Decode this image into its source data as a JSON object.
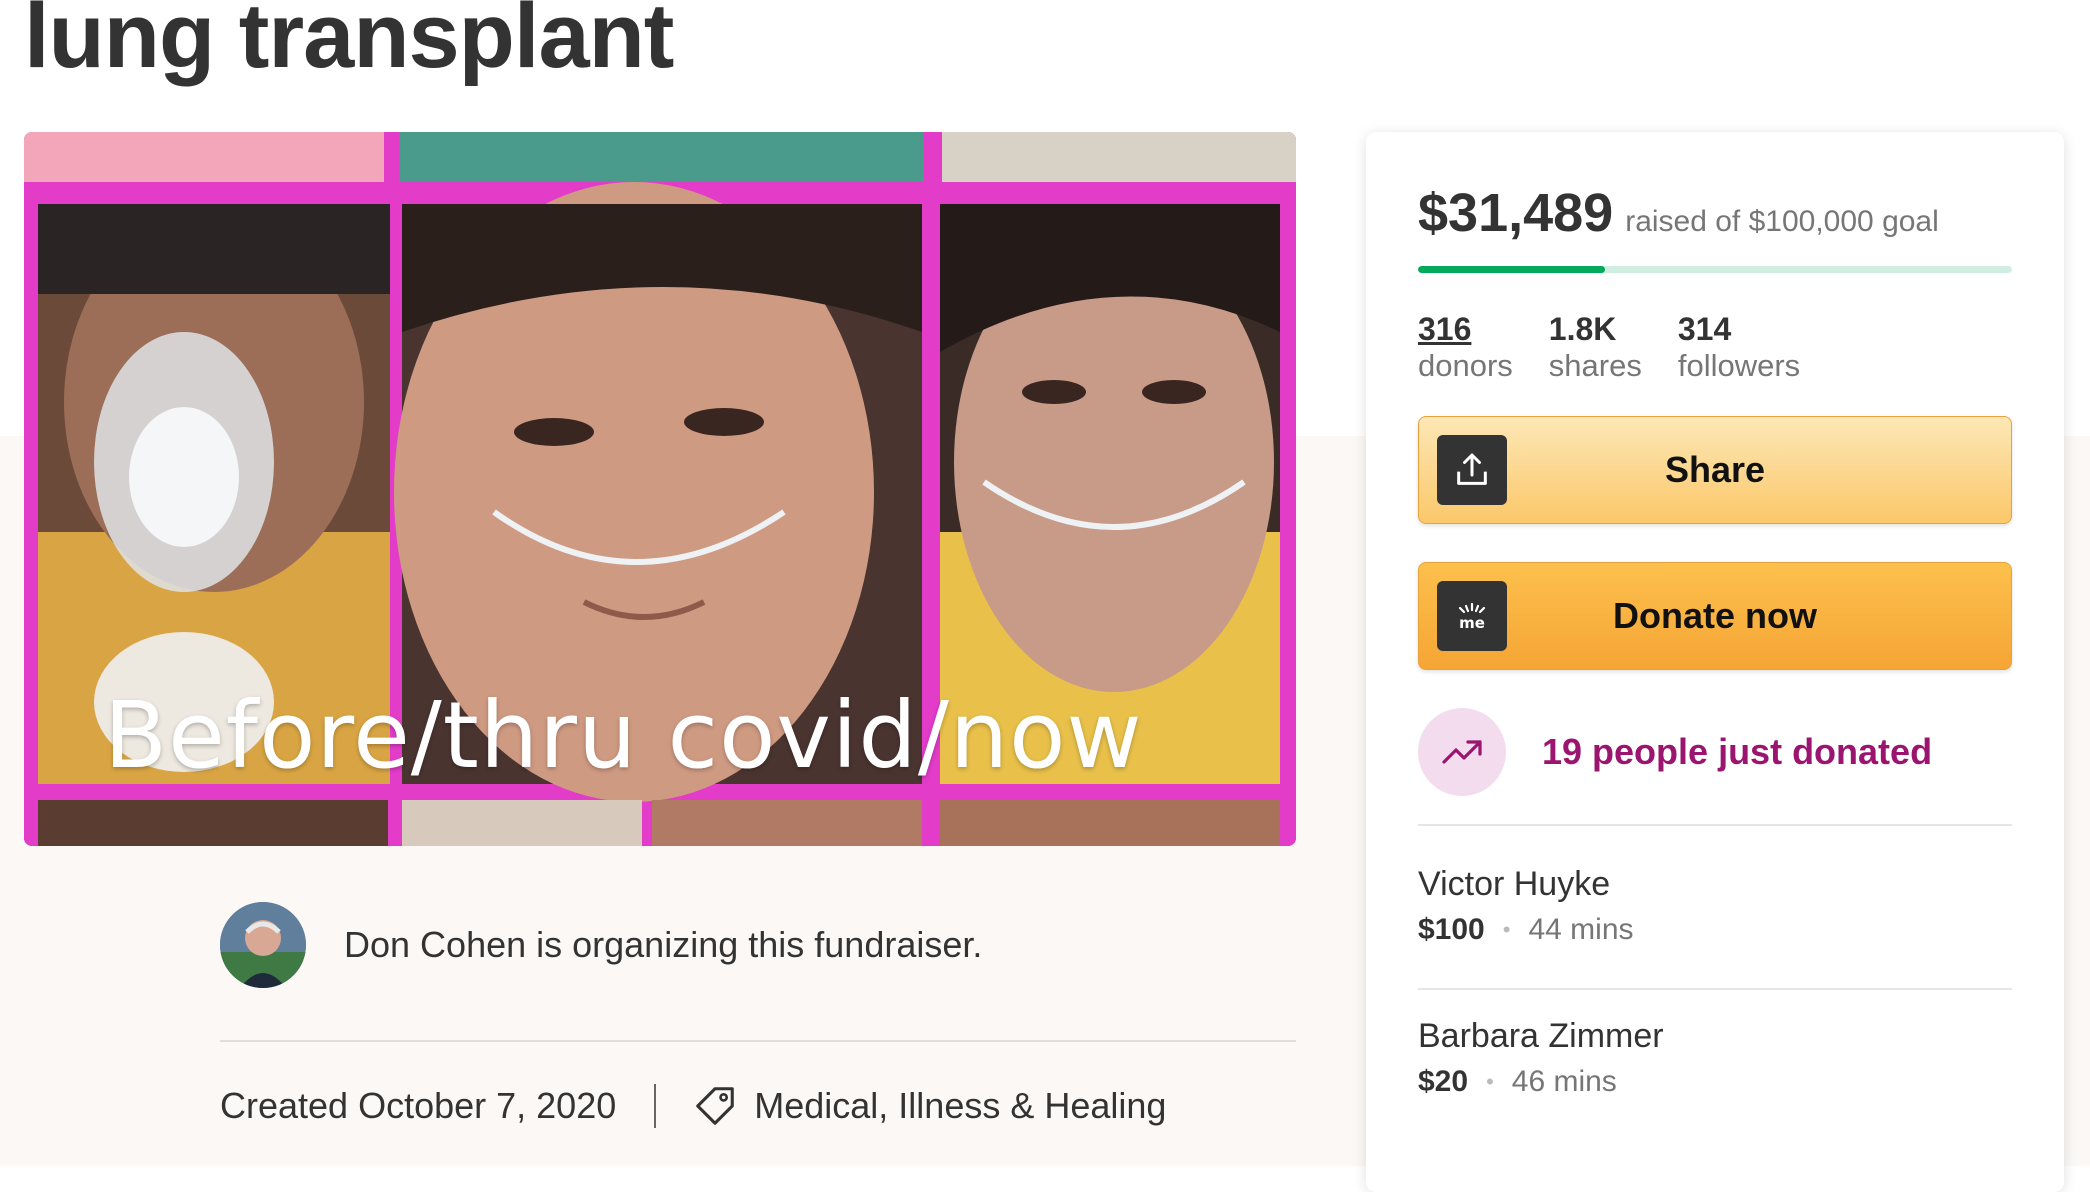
{
  "page": {
    "title": "lung transplant"
  },
  "hero": {
    "caption": "Before/thru covid/now"
  },
  "organizer": {
    "text": "Don Cohen is organizing this fundraiser."
  },
  "meta": {
    "created": "Created October 7, 2020",
    "category": "Medical, Illness & Healing"
  },
  "donation": {
    "amount_raised": "$31,489",
    "goal_text": "raised of $100,000 goal",
    "progress_fraction": 0.31489,
    "colors": {
      "progress": "#02a95c",
      "progress_track": "#cfeee1",
      "button": "#f7b03e",
      "highlight": "#9b1470"
    },
    "stats": [
      {
        "value": "316",
        "label": "donors"
      },
      {
        "value": "1.8K",
        "label": "shares"
      },
      {
        "value": "314",
        "label": "followers"
      }
    ],
    "share_label": "Share",
    "donate_label": "Donate now",
    "recent_text": "19 people just donated",
    "recent_donations": [
      {
        "name": "Victor Huyke",
        "amount": "$100",
        "time": "44 mins"
      },
      {
        "name": "Barbara Zimmer",
        "amount": "$20",
        "time": "46 mins"
      }
    ]
  },
  "icons": [
    "share-icon",
    "gofundme-logo-icon",
    "trending-up-icon",
    "tag-icon"
  ]
}
